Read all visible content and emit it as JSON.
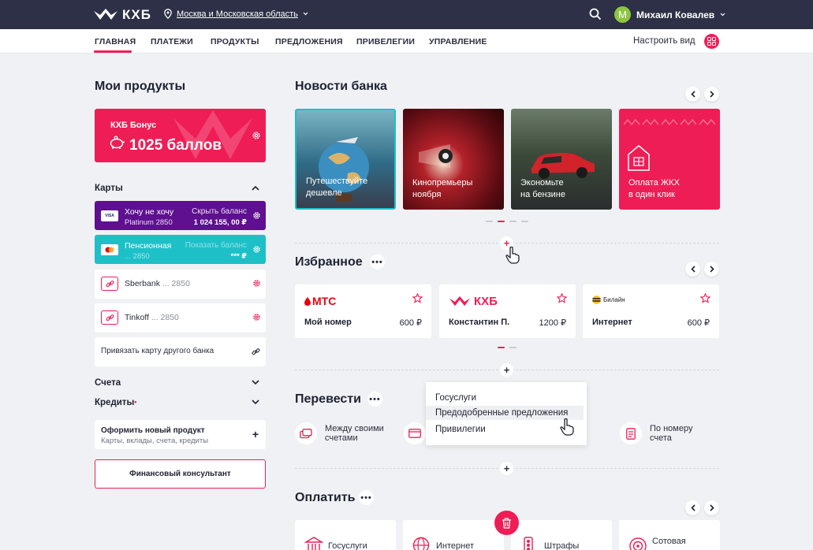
{
  "header": {
    "logo_text": "КХБ",
    "region": "Москва и Московская область",
    "user_initial": "М",
    "user_name": "Михаил Ковалев"
  },
  "nav": {
    "items": [
      "ГЛАВНАЯ",
      "ПЛАТЕЖИ",
      "ПРОДУКТЫ",
      "ПРЕДЛОЖЕНИЯ",
      "ПРИВЕЛЕГИИ",
      "УПРАВЛЕНИЕ"
    ],
    "active": "ГЛАВНАЯ",
    "customize": "Настроить вид"
  },
  "products": {
    "title": "Мои продукты",
    "bonus_label": "КХБ Бонус",
    "bonus_value": "1025 баллов",
    "cards_label": "Карты",
    "cards": [
      {
        "name": "Хочу не хочу",
        "sub": "Platinum 2850",
        "hide": "Скрыть баланс",
        "balance": "1 024 155, 00 ₽",
        "chip": "VISA"
      },
      {
        "name": "Пенсионная",
        "sub": "... 2850",
        "hide": "Показать баланс",
        "balance": "*** ₽"
      }
    ],
    "other_cards": [
      {
        "name": "Sberbank",
        "number": "... 2850"
      },
      {
        "name": "Tinkoff",
        "number": "... 2850"
      }
    ],
    "link_card": "Привязать карту другого банка",
    "accounts_label": "Счета",
    "credits_label": "Кредиты",
    "new_product_title": "Оформить новый продукт",
    "new_product_sub": "Карты, вклады, счета, кредиты",
    "consultant": "Финансовый консультант"
  },
  "news": {
    "title": "Новости банка",
    "items": [
      {
        "line1": "Путешествуйте",
        "line2": "дешевле"
      },
      {
        "line1": "Кинопремьеры",
        "line2": "ноября"
      },
      {
        "line1": "Экономьте",
        "line2": "на бензине"
      },
      {
        "line1": "Оплата ЖКХ",
        "line2": "в один клик"
      }
    ]
  },
  "favorites": {
    "title": "Избранное",
    "items": [
      {
        "logo": "МТС",
        "name": "Мой номер",
        "amount": "600 ₽"
      },
      {
        "logo": "КХБ",
        "name": "Константин П.",
        "amount": "1200 ₽"
      },
      {
        "logo": "Билайн",
        "name": "Интернет",
        "amount": "600 ₽"
      }
    ]
  },
  "transfer": {
    "title": "Перевести",
    "items": [
      {
        "line1": "Между своими",
        "line2": "счетами"
      },
      {
        "line1": "По номеру",
        "line2": "счета"
      }
    ],
    "dropdown": [
      "Госуслуги",
      "Предодобренные предложения",
      "Привилегии"
    ],
    "dropdown_hover": "Предодобренные предложения"
  },
  "pay": {
    "title": "Оплатить",
    "items": [
      "Госуслуги",
      "Интернет",
      "Штрафы",
      "Сотовая"
    ]
  },
  "colors": {
    "brand": "#ef1d55",
    "header_bg": "#2d3046",
    "card_purple": "#5e1090",
    "card_teal": "#1ec0c8",
    "avatar": "#8dc63f"
  }
}
